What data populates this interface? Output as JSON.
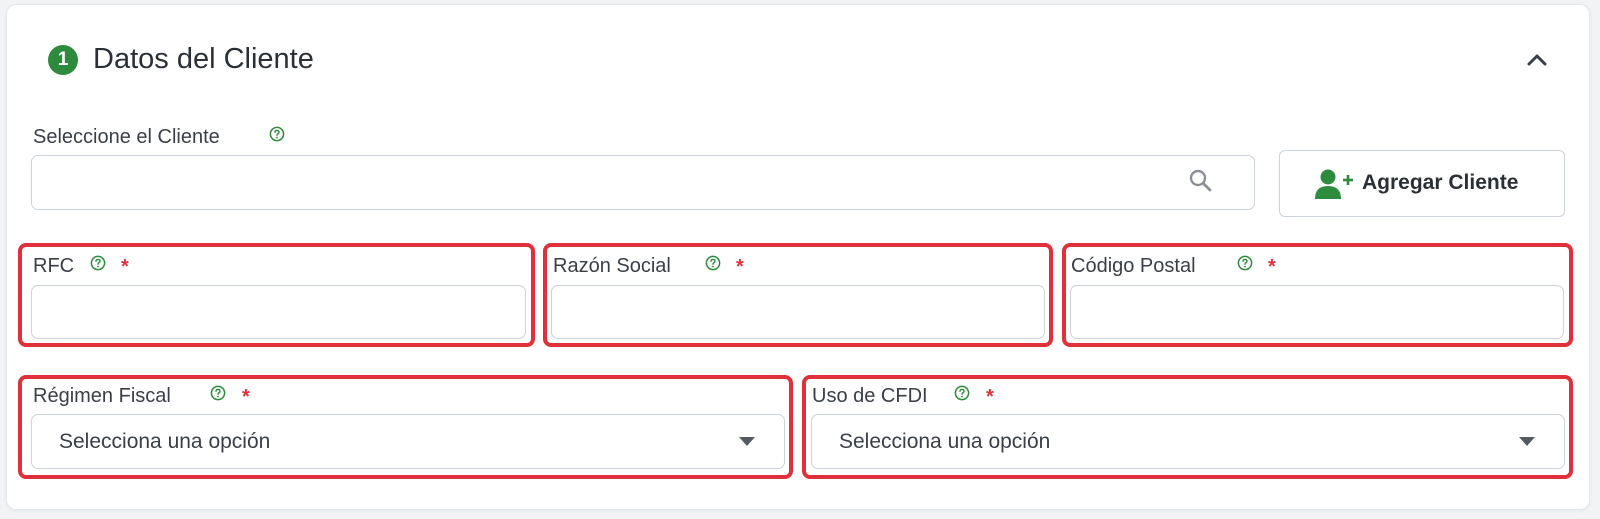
{
  "section": {
    "step_number": "1",
    "title": "Datos del Cliente"
  },
  "client_select": {
    "label": "Seleccione el Cliente",
    "value": "",
    "placeholder": ""
  },
  "add_client_button": {
    "label": "Agregar Cliente"
  },
  "fields": {
    "rfc": {
      "label": "RFC",
      "required_mark": "*",
      "value": ""
    },
    "razon_social": {
      "label": "Razón Social",
      "required_mark": "*",
      "value": ""
    },
    "codigo_postal": {
      "label": "Código Postal",
      "required_mark": "*",
      "value": ""
    },
    "regimen_fiscal": {
      "label": "Régimen Fiscal",
      "required_mark": "*",
      "selected": "Selecciona una opción"
    },
    "uso_cfdi": {
      "label": "Uso de CFDI",
      "required_mark": "*",
      "selected": "Selecciona una opción"
    }
  },
  "icons": {
    "step_badge": "step-number-badge",
    "collapse": "chevron-up-icon",
    "help": "help-circle-icon",
    "search": "search-icon",
    "add_user": "add-user-icon",
    "dropdown": "caret-down-icon"
  },
  "colors": {
    "accent_green": "#2e8b3e",
    "required_red": "#e5303a",
    "highlight_red": "#e0303a",
    "border": "#ccd2da"
  }
}
